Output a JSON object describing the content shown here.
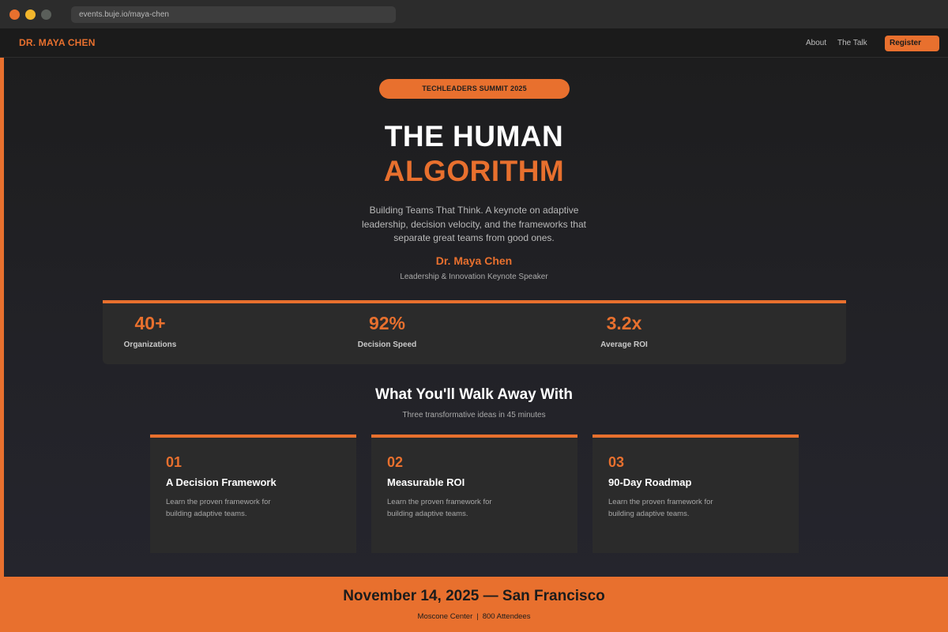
{
  "browser": {
    "url": "events.buje.io/maya-chen",
    "dots": [
      "#e8702e",
      "#f2b62c",
      "#5a5f5a"
    ]
  },
  "nav": {
    "brand": "DR. MAYA CHEN",
    "links": [
      "About",
      "The Talk"
    ],
    "register_label": "Register"
  },
  "hero": {
    "badge": "TECHLEADERS SUMMIT 2025",
    "title_line1": "THE HUMAN",
    "title_line2": "ALGORITHM",
    "tagline": "Building Teams That Think. A keynote on adaptive leadership, decision velocity, and the frameworks that separate great teams from good ones.",
    "speaker_name": "Dr. Maya Chen",
    "speaker_role": "Leadership & Innovation Keynote Speaker"
  },
  "stats": [
    {
      "value": "40+",
      "label": "Organizations"
    },
    {
      "value": "92%",
      "label": "Decision Speed"
    },
    {
      "value": "3.2x",
      "label": "Average ROI"
    }
  ],
  "takeaways": {
    "title": "What You'll Walk Away With",
    "subtitle": "Three transformative ideas in 45 minutes",
    "cards": [
      {
        "num": "01",
        "title": "A Decision Framework",
        "desc": "Learn the proven framework for building adaptive teams."
      },
      {
        "num": "02",
        "title": "Measurable ROI",
        "desc": "Learn the proven framework for building adaptive teams."
      },
      {
        "num": "03",
        "title": "90-Day Roadmap",
        "desc": "Learn the proven framework for building adaptive teams."
      }
    ]
  },
  "footer": {
    "title": "November 14, 2025 — San Francisco",
    "venue": "Moscone Center",
    "separator": "|",
    "attendees": "800 Attendees"
  },
  "colors": {
    "accent": "#e8702e",
    "background": "#1e1e20",
    "card": "#2b2b2b"
  }
}
